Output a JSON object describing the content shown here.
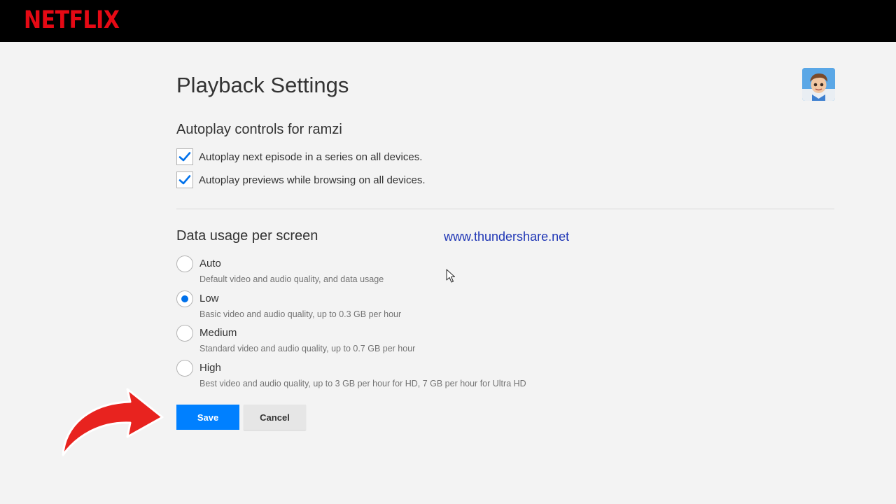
{
  "brand": {
    "logo_text": "NETFLIX",
    "color": "#e50914"
  },
  "page": {
    "title": "Playback Settings"
  },
  "autoplay": {
    "title": "Autoplay controls for ramzi",
    "options": [
      {
        "label": "Autoplay next episode in a series on all devices.",
        "checked": true
      },
      {
        "label": "Autoplay previews while browsing on all devices.",
        "checked": true
      }
    ]
  },
  "data_usage": {
    "title": "Data usage per screen",
    "selected": "Low",
    "options": [
      {
        "label": "Auto",
        "description": "Default video and audio quality, and data usage",
        "selected": false
      },
      {
        "label": "Low",
        "description": "Basic video and audio quality, up to 0.3 GB per hour",
        "selected": true
      },
      {
        "label": "Medium",
        "description": "Standard video and audio quality, up to 0.7 GB per hour",
        "selected": false
      },
      {
        "label": "High",
        "description": "Best video and audio quality, up to 3 GB per hour for HD, 7 GB per hour for Ultra HD",
        "selected": false
      }
    ]
  },
  "watermark": "www.thundershare.net",
  "actions": {
    "save_label": "Save",
    "cancel_label": "Cancel"
  },
  "colors": {
    "accent": "#0080ff",
    "radio_selected": "#0071eb",
    "annotation_arrow": "#e8231f"
  },
  "icons": {
    "avatar": "profile-avatar-icon",
    "checkmark": "checkmark-icon",
    "arrow": "red-curved-arrow-icon",
    "cursor": "mouse-pointer-icon"
  }
}
